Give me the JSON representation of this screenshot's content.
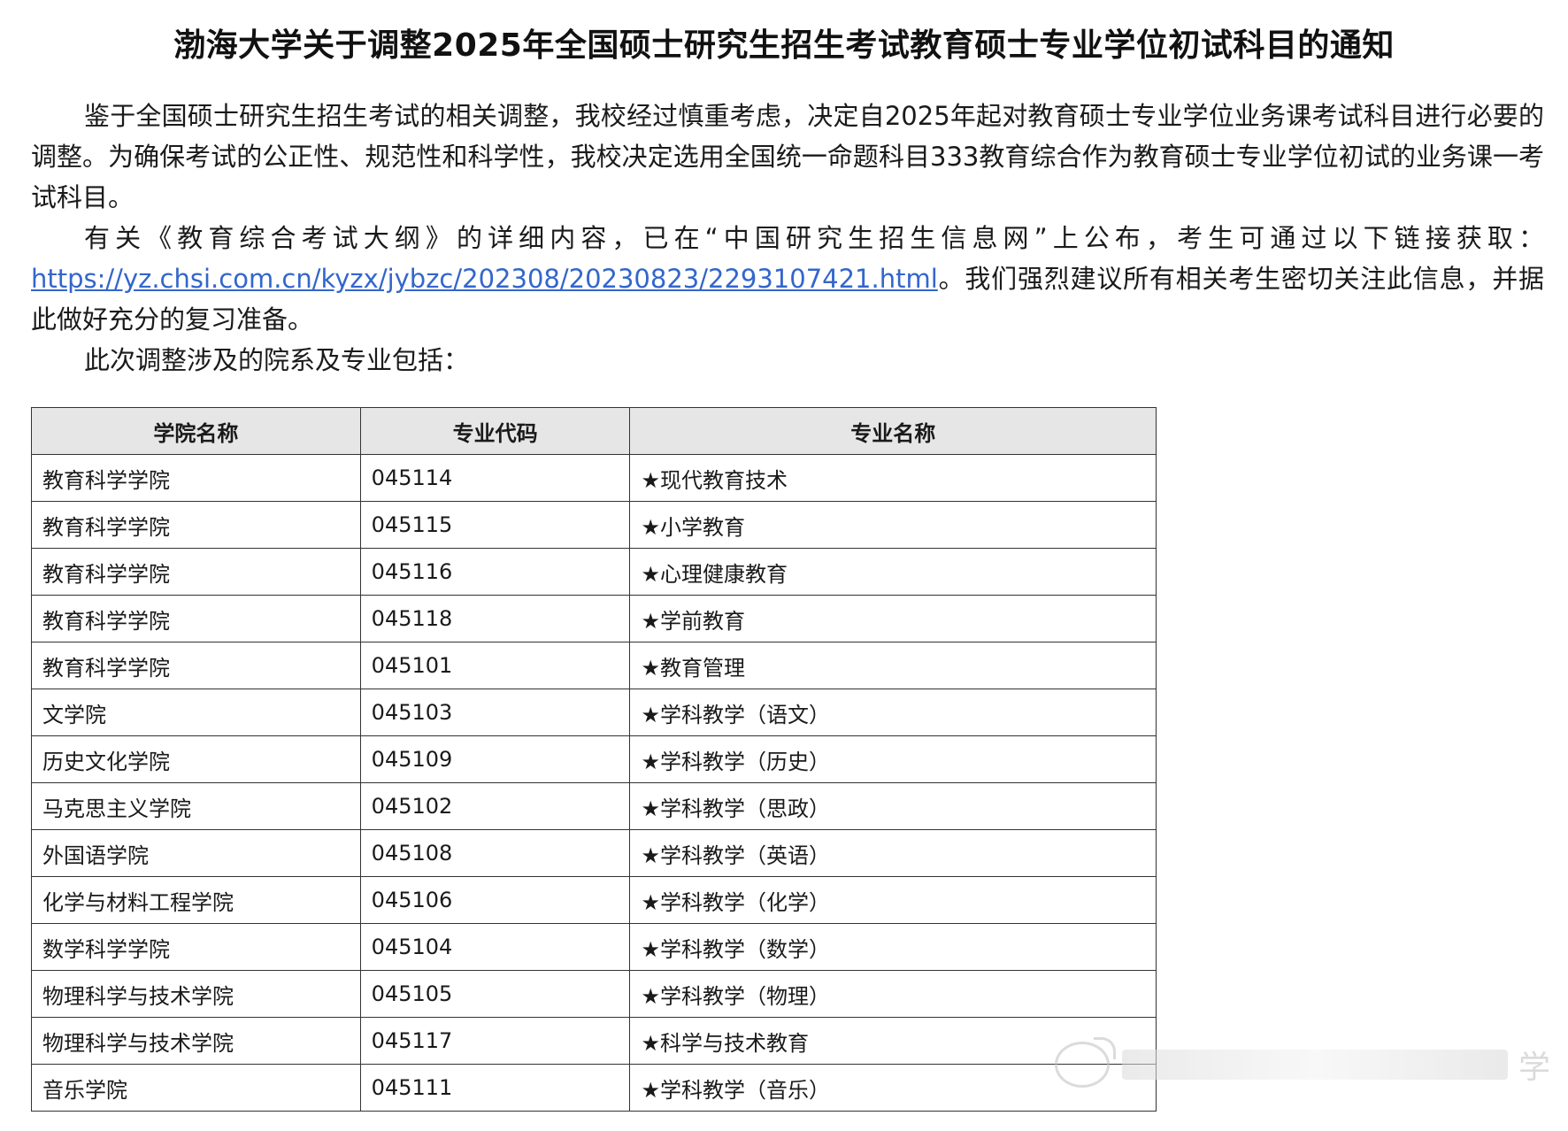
{
  "title": "渤海大学关于调整2025年全国硕士研究生招生考试教育硕士专业学位初试科目的通知",
  "paragraphs": {
    "p1": "鉴于全国硕士研究生招生考试的相关调整，我校经过慎重考虑，决定自2025年起对教育硕士专业学位业务课考试科目进行必要的调整。为确保考试的公正性、规范性和科学性，我校决定选用全国统一命题科目333教育综合作为教育硕士专业学位初试的业务课一考试科目。",
    "p2_before_link": "有关《教育综合考试大纲》的详细内容，已在“中国研究生招生信息网”上公布，考生可通过以下链接获取：",
    "p2_link": "https://yz.chsi.com.cn/kyzx/jybzc/202308/20230823/2293107421.html",
    "p2_after_link": "。我们强烈建议所有相关考生密切关注此信息，并据此做好充分的复习准备。",
    "p3": "此次调整涉及的院系及专业包括："
  },
  "table": {
    "headers": [
      "学院名称",
      "专业代码",
      "专业名称"
    ],
    "rows": [
      [
        "教育科学学院",
        "045114",
        "★现代教育技术"
      ],
      [
        "教育科学学院",
        "045115",
        "★小学教育"
      ],
      [
        "教育科学学院",
        "045116",
        "★心理健康教育"
      ],
      [
        "教育科学学院",
        "045118",
        "★学前教育"
      ],
      [
        "教育科学学院",
        "045101",
        "★教育管理"
      ],
      [
        "文学院",
        "045103",
        "★学科教学（语文）"
      ],
      [
        "历史文化学院",
        "045109",
        "★学科教学（历史）"
      ],
      [
        "马克思主义学院",
        "045102",
        "★学科教学（思政）"
      ],
      [
        "外国语学院",
        "045108",
        "★学科教学（英语）"
      ],
      [
        "化学与材料工程学院",
        "045106",
        "★学科教学（化学）"
      ],
      [
        "数学科学学院",
        "045104",
        "★学科教学（数学）"
      ],
      [
        "物理科学与技术学院",
        "045105",
        "★学科教学（物理）"
      ],
      [
        "物理科学与技术学院",
        "045117",
        "★科学与技术教育"
      ],
      [
        "音乐学院",
        "045111",
        "★学科教学（音乐）"
      ]
    ]
  },
  "watermark": {
    "icon": "weibo-logo-icon",
    "char": "学"
  },
  "colors": {
    "link": "#3366cc",
    "header_bg": "#e6e6e6"
  }
}
